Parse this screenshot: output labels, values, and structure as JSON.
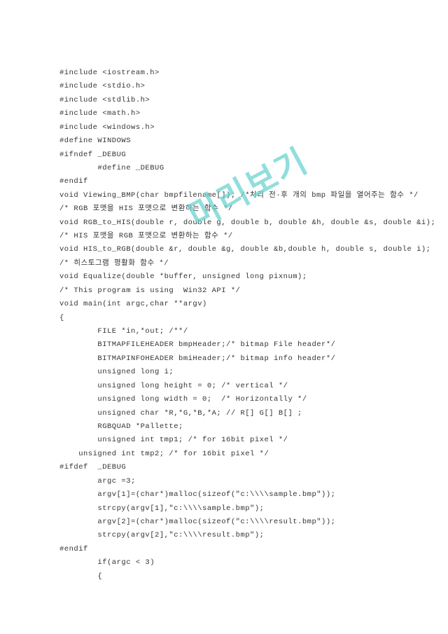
{
  "watermark": "미리보기",
  "code": {
    "lines": [
      "#include <iostream.h>",
      "#include <stdio.h>",
      "#include <stdlib.h>",
      "#include <math.h>",
      "#include <windows.h>",
      "",
      "#define WINDOWS",
      "#ifndef _DEBUG",
      "        #define _DEBUG",
      "#endif",
      "",
      "void Viewing_BMP(char bmpfilename[]); /*처리 전·후 개의 bmp 파일을 열어주는 함수 */",
      "/* RGB 포맷을 HIS 포맷으로 변환하는 함수 */",
      "void RGB_to_HIS(double r, double g, double b, double &h, double &s, double &i);",
      "/* HIS 포맷을 RGB 포맷으로 변환하는 함수 */",
      "void HIS_to_RGB(double &r, double &g, double &b,double h, double s, double i);",
      "/* 히스토그램 평활화 함수 */",
      "void Equalize(double *buffer, unsigned long pixnum);",
      "",
      "/* This program is using  Win32 API */",
      "void main(int argc,char **argv)",
      "{",
      "        FILE *in,*out; /**/",
      "        BITMAPFILEHEADER bmpHeader;/* bitmap File header*/",
      "        BITMAPINFOHEADER bmiHeader;/* bitmap info header*/",
      "        unsigned long i;",
      "        unsigned long height = 0; /* vertical */",
      "        unsigned long width = 0;  /* Horizontally */",
      "        unsigned char *R,*G,*B,*A; // R[] G[] B[] ;",
      "        RGBQUAD *Pallette;",
      "        unsigned int tmp1; /* for 16bit pixel */",
      "    unsigned int tmp2; /* for 16bit pixel */",
      "#ifdef  _DEBUG",
      "        argc =3;",
      "        argv[1]=(char*)malloc(sizeof(\"c:\\\\\\\\sample.bmp\"));",
      "        strcpy(argv[1],\"c:\\\\\\\\sample.bmp\");",
      "        argv[2]=(char*)malloc(sizeof(\"c:\\\\\\\\result.bmp\"));",
      "        strcpy(argv[2],\"c:\\\\\\\\result.bmp\");",
      "#endif",
      "        if(argc < 3)",
      "        {"
    ]
  }
}
